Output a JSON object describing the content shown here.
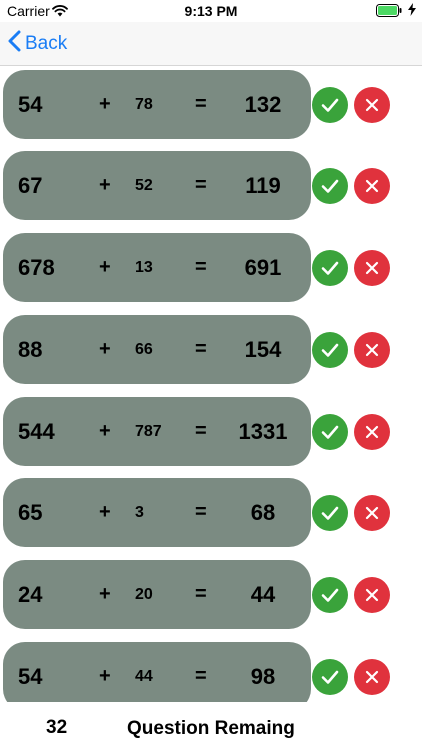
{
  "status_bar": {
    "carrier": "Carrier",
    "time": "9:13 PM"
  },
  "nav": {
    "back_label": "Back"
  },
  "rows": [
    {
      "a": "54",
      "op": "+",
      "b": "78",
      "eq": "=",
      "result": "132"
    },
    {
      "a": "67",
      "op": "+",
      "b": "52",
      "eq": "=",
      "result": "119"
    },
    {
      "a": "678",
      "op": "+",
      "b": "13",
      "eq": "=",
      "result": "691"
    },
    {
      "a": "88",
      "op": "+",
      "b": "66",
      "eq": "=",
      "result": "154"
    },
    {
      "a": "544",
      "op": "+",
      "b": "787",
      "eq": "=",
      "result": "1331"
    },
    {
      "a": "65",
      "op": "+",
      "b": "3",
      "eq": "=",
      "result": "68"
    },
    {
      "a": "24",
      "op": "+",
      "b": "20",
      "eq": "=",
      "result": "44"
    },
    {
      "a": "54",
      "op": "+",
      "b": "44",
      "eq": "=",
      "result": "98"
    }
  ],
  "footer": {
    "remaining_count": "32",
    "remaining_label": "Question Remaing"
  },
  "colors": {
    "card": "#7b8b82",
    "correct": "#3aa33b",
    "wrong": "#e0323d",
    "accent": "#1a7df5"
  },
  "icons": {
    "correct": "checkmark-icon",
    "wrong": "close-icon",
    "back": "chevron-left-icon"
  }
}
